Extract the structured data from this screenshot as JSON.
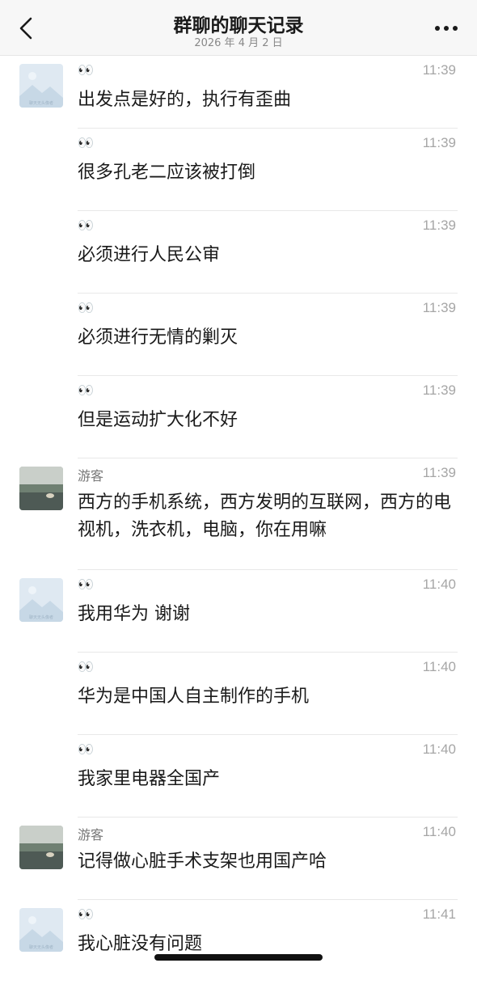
{
  "header": {
    "title": "群聊的聊天记录",
    "date": "2026 年 4 月 2 日",
    "back_icon": "chevron-left-icon",
    "more_icon": "more-dots-icon"
  },
  "avatars": {
    "placeholder_caption": "聊天无头像者"
  },
  "messages": [
    {
      "sender": "👀",
      "time": "11:39",
      "text": "出发点是好的，执行有歪曲",
      "avatar": "placeholder"
    },
    {
      "sender": "👀",
      "time": "11:39",
      "text": "很多孔老二应该被打倒",
      "avatar": null
    },
    {
      "sender": "👀",
      "time": "11:39",
      "text": "必须进行人民公审",
      "avatar": null
    },
    {
      "sender": "👀",
      "time": "11:39",
      "text": "必须进行无情的剿灭",
      "avatar": null
    },
    {
      "sender": "👀",
      "time": "11:39",
      "text": "但是运动扩大化不好",
      "avatar": null
    },
    {
      "sender": "游客",
      "time": "11:39",
      "text": "西方的手机系统，西方发明的互联网，西方的电视机，洗衣机，电脑，你在用嘛",
      "avatar": "photo"
    },
    {
      "sender": "👀",
      "time": "11:40",
      "text": "我用华为 谢谢",
      "avatar": "placeholder"
    },
    {
      "sender": "👀",
      "time": "11:40",
      "text": "华为是中国人自主制作的手机",
      "avatar": null
    },
    {
      "sender": "👀",
      "time": "11:40",
      "text": "我家里电器全国产",
      "avatar": null
    },
    {
      "sender": "游客",
      "time": "11:40",
      "text": "记得做心脏手术支架也用国产哈",
      "avatar": "photo"
    },
    {
      "sender": "👀",
      "time": "11:41",
      "text": "我心脏没有问题",
      "avatar": "placeholder"
    }
  ]
}
